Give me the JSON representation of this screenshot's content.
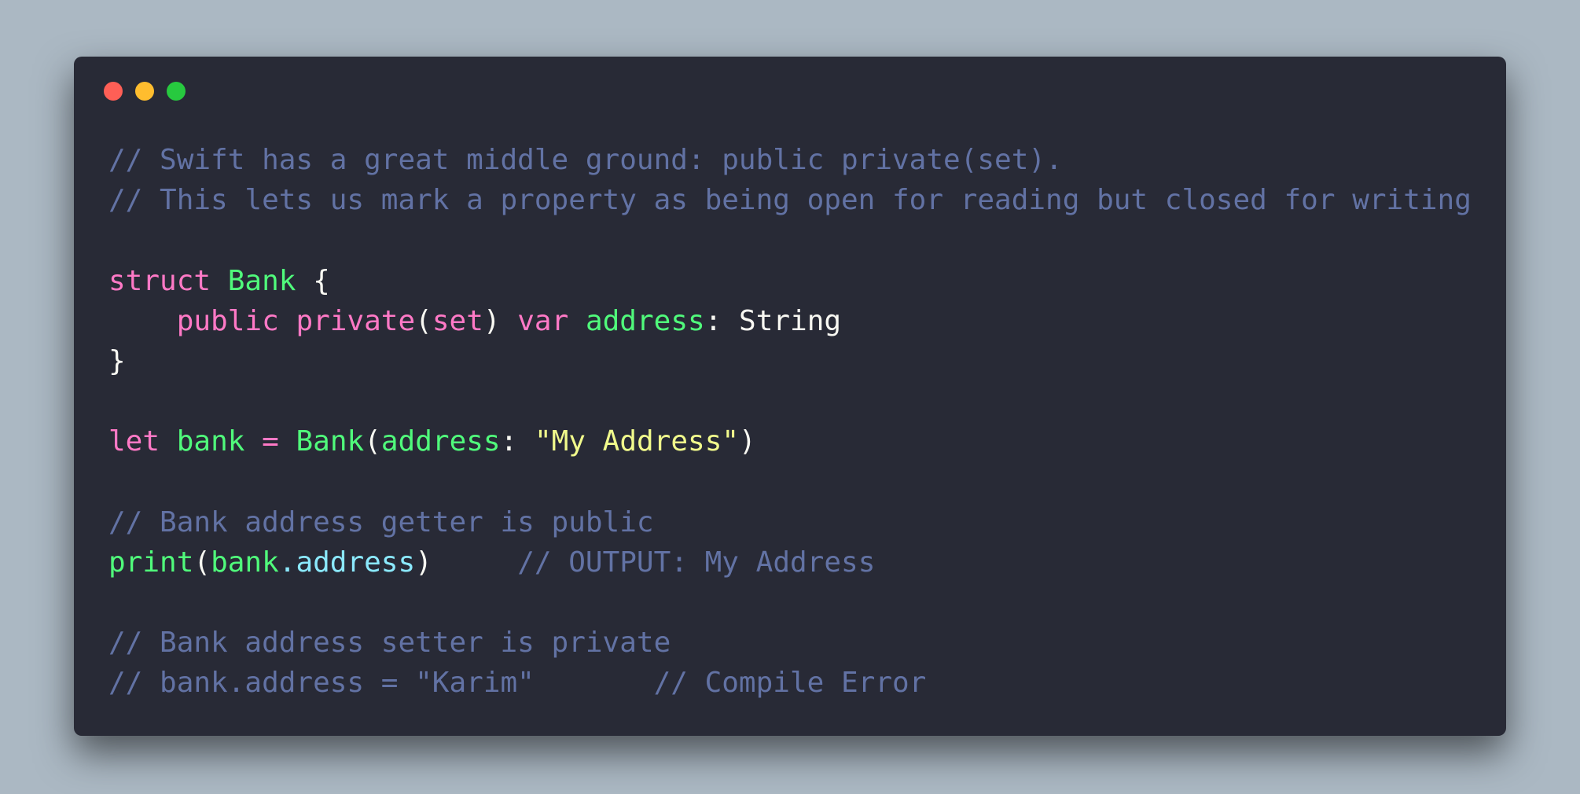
{
  "window": {
    "controls": [
      {
        "name": "close",
        "color": "#ff5f56"
      },
      {
        "name": "minimize",
        "color": "#ffbd2e"
      },
      {
        "name": "maximize",
        "color": "#27c93f"
      }
    ]
  },
  "theme": {
    "background": "#abb8c3",
    "editor_background": "#282a36",
    "comment": "#6272a4",
    "keyword": "#ff79c6",
    "identifier": "#50fa7b",
    "string": "#f1fa8c",
    "property": "#8be9fd",
    "text": "#f8f8f2"
  },
  "code": {
    "language": "Swift",
    "lines": [
      [
        {
          "t": "// Swift has a great middle ground: public private(set).",
          "s": "c"
        }
      ],
      [
        {
          "t": "// This lets us mark a property as being open for reading but closed for writing",
          "s": "c"
        }
      ],
      [],
      [
        {
          "t": "struct",
          "s": "k"
        },
        {
          "t": " ",
          "s": "w"
        },
        {
          "t": "Bank",
          "s": "g"
        },
        {
          "t": " {",
          "s": "w"
        }
      ],
      [
        {
          "t": "    ",
          "s": "w"
        },
        {
          "t": "public",
          "s": "k"
        },
        {
          "t": " ",
          "s": "w"
        },
        {
          "t": "private",
          "s": "k"
        },
        {
          "t": "(",
          "s": "w"
        },
        {
          "t": "set",
          "s": "k"
        },
        {
          "t": ") ",
          "s": "w"
        },
        {
          "t": "var",
          "s": "k"
        },
        {
          "t": " ",
          "s": "w"
        },
        {
          "t": "address",
          "s": "g"
        },
        {
          "t": ": String",
          "s": "w"
        }
      ],
      [
        {
          "t": "}",
          "s": "w"
        }
      ],
      [],
      [
        {
          "t": "let",
          "s": "k"
        },
        {
          "t": " ",
          "s": "w"
        },
        {
          "t": "bank",
          "s": "g"
        },
        {
          "t": " ",
          "s": "w"
        },
        {
          "t": "=",
          "s": "k"
        },
        {
          "t": " ",
          "s": "w"
        },
        {
          "t": "Bank",
          "s": "g"
        },
        {
          "t": "(",
          "s": "w"
        },
        {
          "t": "address",
          "s": "g"
        },
        {
          "t": ": ",
          "s": "w"
        },
        {
          "t": "\"My Address\"",
          "s": "y"
        },
        {
          "t": ")",
          "s": "w"
        }
      ],
      [],
      [
        {
          "t": "// Bank address getter is public",
          "s": "c"
        }
      ],
      [
        {
          "t": "print",
          "s": "g"
        },
        {
          "t": "(",
          "s": "w"
        },
        {
          "t": "bank",
          "s": "g"
        },
        {
          "t": ".address",
          "s": "b"
        },
        {
          "t": ")",
          "s": "w"
        },
        {
          "t": "     ",
          "s": "w"
        },
        {
          "t": "// OUTPUT: My Address",
          "s": "c"
        }
      ],
      [],
      [
        {
          "t": "// Bank address setter is private",
          "s": "c"
        }
      ],
      [
        {
          "t": "// bank.address = \"Karim\"       // Compile Error",
          "s": "c"
        }
      ]
    ]
  }
}
